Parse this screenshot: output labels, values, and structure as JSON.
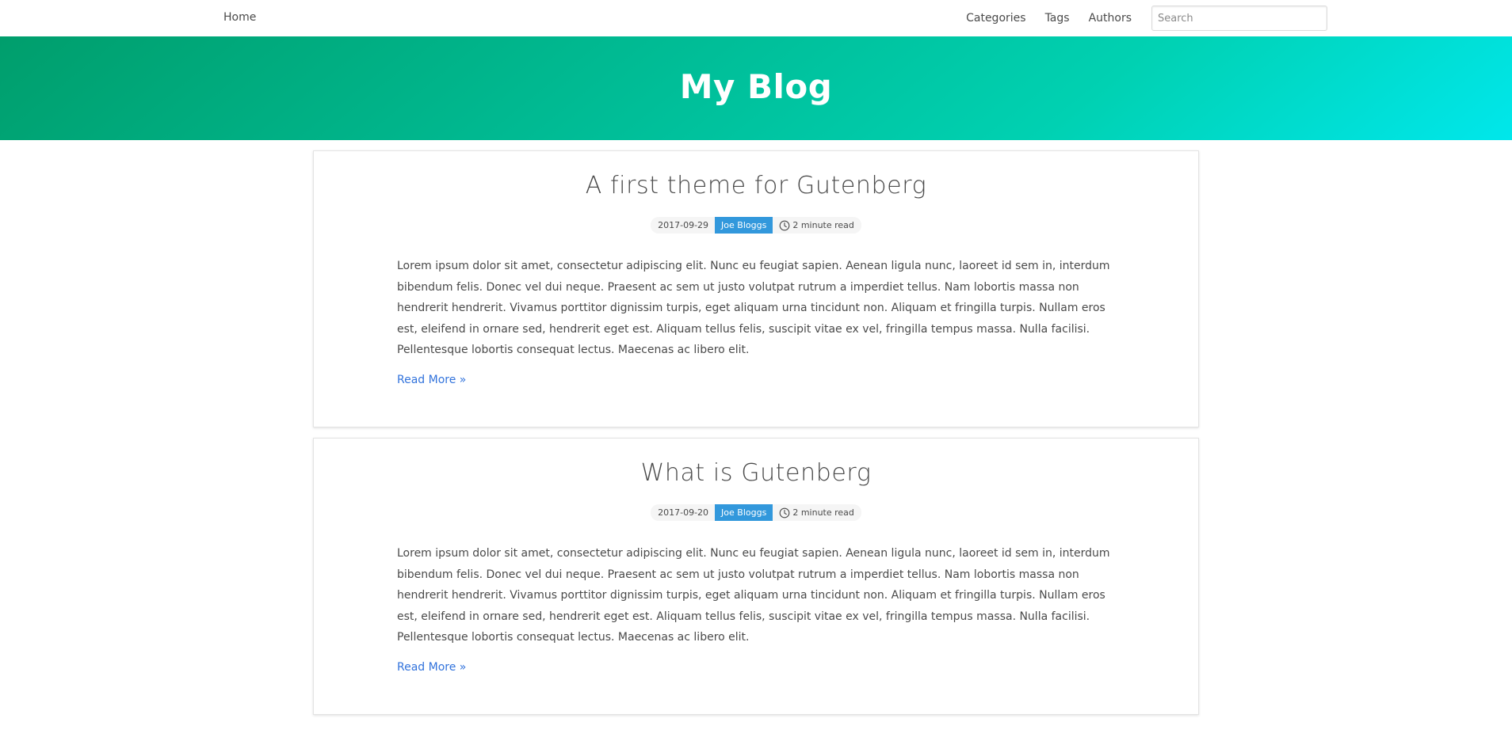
{
  "nav": {
    "home_label": "Home",
    "links": [
      "Categories",
      "Tags",
      "Authors"
    ],
    "search_placeholder": "Search"
  },
  "hero": {
    "title": "My Blog",
    "gradient_colors": [
      "#009e6c",
      "#00d1b2",
      "#00e7eb"
    ]
  },
  "posts": [
    {
      "title": "A first theme for Gutenberg",
      "date": "2017-09-29",
      "author": "Joe Bloggs",
      "read_time": "2 minute read",
      "excerpt": "Lorem ipsum dolor sit amet, consectetur adipiscing elit. Nunc eu feugiat sapien. Aenean ligula nunc, laoreet id sem in, interdum bibendum felis. Donec vel dui neque. Praesent ac sem ut justo volutpat rutrum a imperdiet tellus. Nam lobortis massa non hendrerit hendrerit. Vivamus porttitor dignissim turpis, eget aliquam urna tincidunt non. Aliquam et fringilla turpis. Nullam eros est, eleifend in ornare sed, hendrerit eget est. Aliquam tellus felis, suscipit vitae ex vel, fringilla tempus massa. Nulla facilisi. Pellentesque lobortis consequat lectus. Maecenas ac libero elit.",
      "read_more": "Read More »"
    },
    {
      "title": "What is Gutenberg",
      "date": "2017-09-20",
      "author": "Joe Bloggs",
      "read_time": "2 minute read",
      "excerpt": "Lorem ipsum dolor sit amet, consectetur adipiscing elit. Nunc eu feugiat sapien. Aenean ligula nunc, laoreet id sem in, interdum bibendum felis. Donec vel dui neque. Praesent ac sem ut justo volutpat rutrum a imperdiet tellus. Nam lobortis massa non hendrerit hendrerit. Vivamus porttitor dignissim turpis, eget aliquam urna tincidunt non. Aliquam et fringilla turpis. Nullam eros est, eleifend in ornare sed, hendrerit eget est. Aliquam tellus felis, suscipit vitae ex vel, fringilla tempus massa. Nulla facilisi. Pellentesque lobortis consequat lectus. Maecenas ac libero elit.",
      "read_more": "Read More »"
    }
  ],
  "colors": {
    "author_tag": "#3298dc",
    "link": "#3273dc",
    "meta_tag_bg": "#f5f5f5"
  }
}
